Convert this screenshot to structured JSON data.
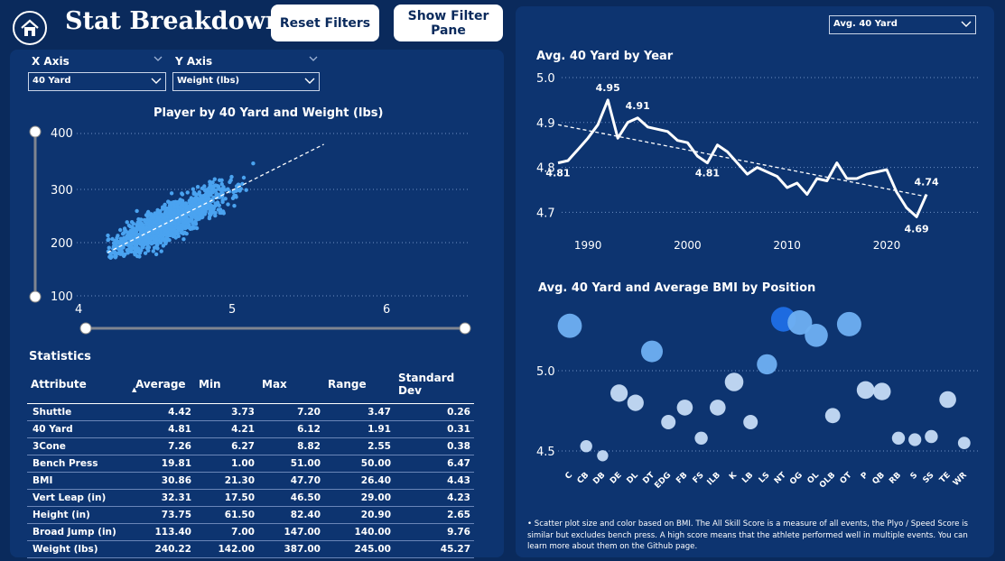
{
  "header": {
    "title": "Stat Breakdown",
    "reset_label": "Reset Filters",
    "filter_pane_label": "Show Filter Pane"
  },
  "colors": {
    "background": "#0a2a5c",
    "panel": "#0d3470",
    "scatter_point": "#4aa3f0",
    "bubble_light": "#b9d5f5",
    "bubble_dark": "#1e78e6"
  },
  "controls": {
    "x_axis_label": "X Axis",
    "y_axis_label": "Y Axis",
    "x_axis_value": "40 Yard",
    "y_axis_value": "Weight (lbs)",
    "right_select_value": "Avg. 40 Yard"
  },
  "scatter": {
    "title": "Player by 40 Yard and Weight (lbs)",
    "x_ticks": [
      "4",
      "5",
      "6"
    ],
    "y_ticks": [
      "400",
      "300",
      "200",
      "100"
    ]
  },
  "stats": {
    "title": "Statistics",
    "columns": [
      "Attribute",
      "Average",
      "Min",
      "Max",
      "Range",
      "Standard Dev"
    ],
    "rows": [
      [
        "Shuttle",
        "4.42",
        "3.73",
        "7.20",
        "3.47",
        "0.26"
      ],
      [
        "40 Yard",
        "4.81",
        "4.21",
        "6.12",
        "1.91",
        "0.31"
      ],
      [
        "3Cone",
        "7.26",
        "6.27",
        "8.82",
        "2.55",
        "0.38"
      ],
      [
        "Bench Press",
        "19.81",
        "1.00",
        "51.00",
        "50.00",
        "6.47"
      ],
      [
        "BMI",
        "30.86",
        "21.30",
        "47.70",
        "26.40",
        "4.43"
      ],
      [
        "Vert Leap (in)",
        "32.31",
        "17.50",
        "46.50",
        "29.00",
        "4.23"
      ],
      [
        "Height (in)",
        "73.75",
        "61.50",
        "82.40",
        "20.90",
        "2.65"
      ],
      [
        "Broad Jump (in)",
        "113.40",
        "7.00",
        "147.00",
        "140.00",
        "9.76"
      ],
      [
        "Weight (lbs)",
        "240.22",
        "142.00",
        "387.00",
        "245.00",
        "45.27"
      ]
    ]
  },
  "footnote": "• Scatter plot size and color based on BMI. The All Skill Score is a measure of all events, the Plyo / Speed Score is similar but excludes bench press. A high score means that the athlete performed well in multiple events. You can learn more about them on the Github page.",
  "chart_data": [
    {
      "type": "scatter",
      "title": "Player by 40 Yard and Weight (lbs)",
      "xlim": [
        4,
        6
      ],
      "ylim": [
        100,
        400
      ],
      "x_ticks": [
        4,
        5,
        6
      ],
      "y_ticks": [
        100,
        200,
        300,
        400
      ],
      "note": "dense cloud of individual player points with dashed linear trend line",
      "trend_line": [
        [
          4.2,
          180
        ],
        [
          5.6,
          380
        ]
      ],
      "grid": "horizontal dotted"
    },
    {
      "type": "line",
      "title": "Avg. 40 Yard by Year",
      "ylim": [
        4.65,
        5.0
      ],
      "x_ticks": [
        "1990",
        "2000",
        "2010",
        "2020"
      ],
      "y_ticks": [
        "5.0",
        "4.9",
        "4.8",
        "4.7"
      ],
      "x": [
        1987,
        1988,
        1989,
        1990,
        1991,
        1992,
        1993,
        1994,
        1995,
        1996,
        1997,
        1998,
        1999,
        2000,
        2001,
        2002,
        2003,
        2004,
        2005,
        2006,
        2007,
        2008,
        2009,
        2010,
        2011,
        2012,
        2013,
        2014,
        2015,
        2016,
        2017,
        2018,
        2019,
        2020,
        2021,
        2022,
        2023,
        2024
      ],
      "values": [
        4.81,
        4.815,
        4.84,
        4.865,
        4.895,
        4.95,
        4.865,
        4.9,
        4.91,
        4.89,
        4.885,
        4.88,
        4.86,
        4.855,
        4.825,
        4.81,
        4.85,
        4.835,
        4.81,
        4.785,
        4.8,
        4.79,
        4.78,
        4.755,
        4.765,
        4.74,
        4.775,
        4.77,
        4.81,
        4.775,
        4.775,
        4.785,
        4.79,
        4.795,
        4.745,
        4.71,
        4.69,
        4.74
      ],
      "data_labels": [
        [
          "1987",
          "4.81"
        ],
        [
          "1992",
          "4.95"
        ],
        [
          "1995",
          "4.91"
        ],
        [
          "2002",
          "4.81"
        ],
        [
          "2023",
          "4.69"
        ],
        [
          "2024",
          "4.74"
        ]
      ],
      "trend_line": [
        [
          1987,
          4.895
        ],
        [
          2024,
          4.735
        ]
      ],
      "grid": "horizontal dotted"
    },
    {
      "type": "scatter",
      "title": "Avg. 40 Yard and Average BMI by Position",
      "categories": [
        "C",
        "CB",
        "DB",
        "DE",
        "DL",
        "DT",
        "EDG",
        "FB",
        "FS",
        "ILB",
        "K",
        "LB",
        "LS",
        "NT",
        "OG",
        "OL",
        "OLB",
        "OT",
        "P",
        "QB",
        "RB",
        "S",
        "SS",
        "TE",
        "WR"
      ],
      "values": [
        5.28,
        4.53,
        4.47,
        4.86,
        4.8,
        5.12,
        4.68,
        4.77,
        4.58,
        4.77,
        4.93,
        4.68,
        5.04,
        5.32,
        5.3,
        5.22,
        4.72,
        5.29,
        4.88,
        4.87,
        4.58,
        4.57,
        4.59,
        4.82,
        4.55
      ],
      "y_ticks": [
        "5.0",
        "4.5"
      ],
      "ylim": [
        4.45,
        5.35
      ],
      "size_and_color": "BMI",
      "grid": "horizontal dotted"
    }
  ]
}
